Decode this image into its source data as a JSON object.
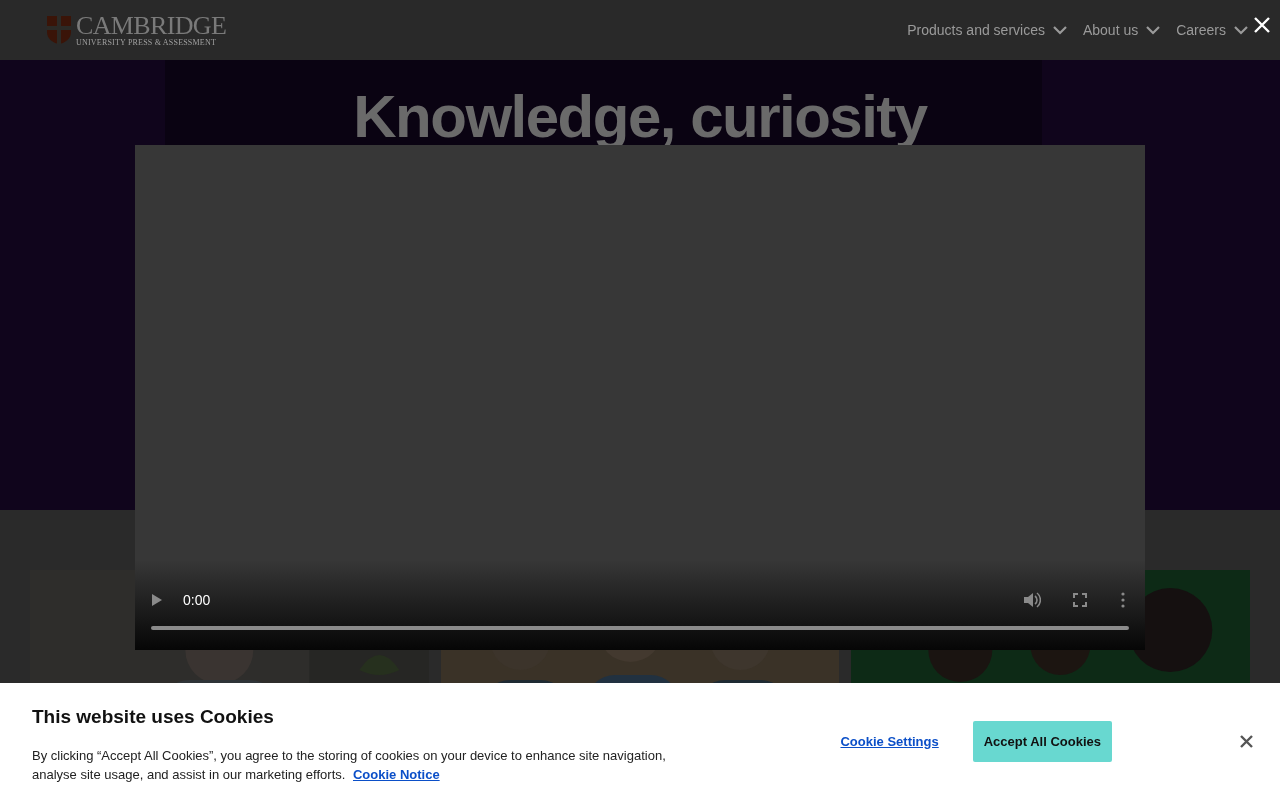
{
  "header": {
    "logo_name": "CAMBRIDGE",
    "logo_tagline": "UNIVERSITY PRESS & ASSESSMENT",
    "nav": [
      {
        "label": "Products and services"
      },
      {
        "label": "About us"
      },
      {
        "label": "Careers"
      }
    ]
  },
  "hero": {
    "heading": "Knowledge, curiosity"
  },
  "video": {
    "time": "0:00",
    "level": 0
  },
  "cookie_banner": {
    "title": "This website uses Cookies",
    "text": "By clicking “Accept All Cookies”, you agree to the storing of cookies on your device to enhance site navigation, analyse site usage, and assist in our marketing efforts.",
    "link": "Cookie Notice",
    "buttons": [
      {
        "label": "Cookie Settings",
        "kind": "link"
      },
      {
        "label": "Accept All Cookies",
        "kind": "primary"
      }
    ]
  }
}
